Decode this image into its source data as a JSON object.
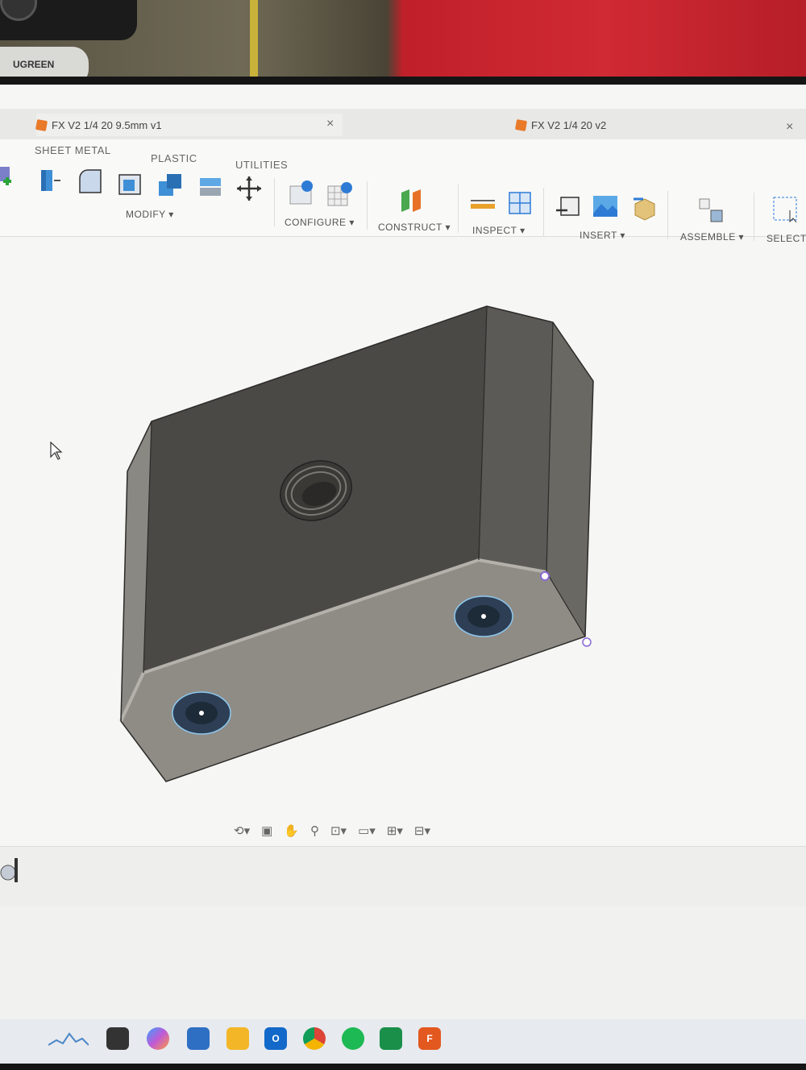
{
  "webcam": {
    "brand": "UGREEN"
  },
  "tabs": [
    {
      "title": "FX V2 1/4 20 9.5mm v1",
      "close": "×"
    },
    {
      "title": "FX V2 1/4 20 v2",
      "close": "×"
    }
  ],
  "ribbon": {
    "categories": [
      "SHEET METAL",
      "PLASTIC",
      "UTILITIES"
    ],
    "groups": {
      "modify": "MODIFY",
      "configure": "CONFIGURE",
      "construct": "CONSTRUCT",
      "inspect": "INSPECT",
      "insert": "INSERT",
      "assemble": "ASSEMBLE",
      "select": "SELECT"
    },
    "dropdown_marker": "▾"
  },
  "model": {
    "part_color": "#6e6b66",
    "hole_count": 3
  },
  "colors": {
    "accent_orange": "#e87a2a",
    "wall_red": "#d02a34"
  },
  "taskbar": {
    "items": [
      "widgets-icon",
      "desktop-icon",
      "copilot-icon",
      "store-icon",
      "file-explorer-icon",
      "outlook-icon",
      "chrome-icon",
      "spotify-icon",
      "excel-icon",
      "fusion-icon"
    ]
  }
}
